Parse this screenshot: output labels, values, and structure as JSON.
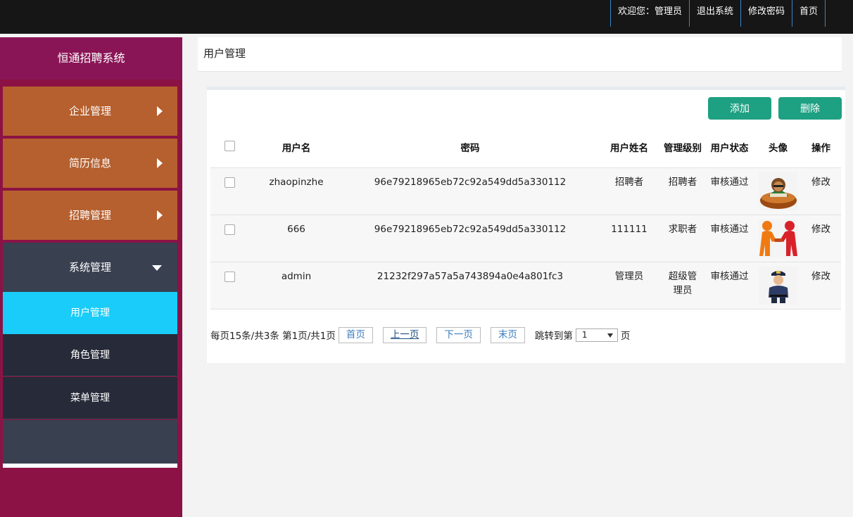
{
  "topnav": {
    "welcome": "欢迎您：管理员",
    "logout": "退出系统",
    "change_password": "修改密码",
    "home": "首页"
  },
  "sidebar": {
    "brand": "恒通招聘系统",
    "menus": [
      {
        "label": "企业管理"
      },
      {
        "label": "简历信息"
      },
      {
        "label": "招聘管理"
      }
    ],
    "system": {
      "label": "系统管理",
      "children": [
        {
          "label": "用户管理"
        },
        {
          "label": "角色管理"
        },
        {
          "label": "菜单管理"
        }
      ]
    }
  },
  "breadcrumb": "用户管理",
  "toolbar": {
    "add": "添加",
    "delete": "删除"
  },
  "table": {
    "headers": [
      "用户名",
      "密码",
      "用户姓名",
      "管理级别",
      "用户状态",
      "头像",
      "操作"
    ],
    "rows": [
      {
        "username": "zhaopinzhe",
        "password": "96e79218965eb72c92a549dd5a330112",
        "name": "招聘者",
        "level": "招聘者",
        "status": "审核通过",
        "avatar": "woman-at-desk-avatar",
        "action": "修改"
      },
      {
        "username": "666",
        "password": "96e79218965eb72c92a549dd5a330112",
        "name": "111111",
        "level": "求职者",
        "status": "审核通过",
        "avatar": "handshake-avatar",
        "action": "修改"
      },
      {
        "username": "admin",
        "password": "21232f297a57a5a743894a0e4a801fc3",
        "name": "管理员",
        "level": "超级管理员",
        "status": "审核通过",
        "avatar": "police-officer-avatar",
        "action": "修改"
      }
    ]
  },
  "pager": {
    "summary": "每页15条/共3条 第1页/共1页",
    "first": "首页",
    "prev": "上一页",
    "next": "下一页",
    "last": "末页",
    "jump_label": "跳转到第",
    "page_value": "1",
    "page_suffix": "页"
  },
  "colors": {
    "topbar": "#161616",
    "sidebar": "#8c1245",
    "menu": "#b5602e",
    "active": "#19ccf9",
    "button": "#1ea082"
  }
}
